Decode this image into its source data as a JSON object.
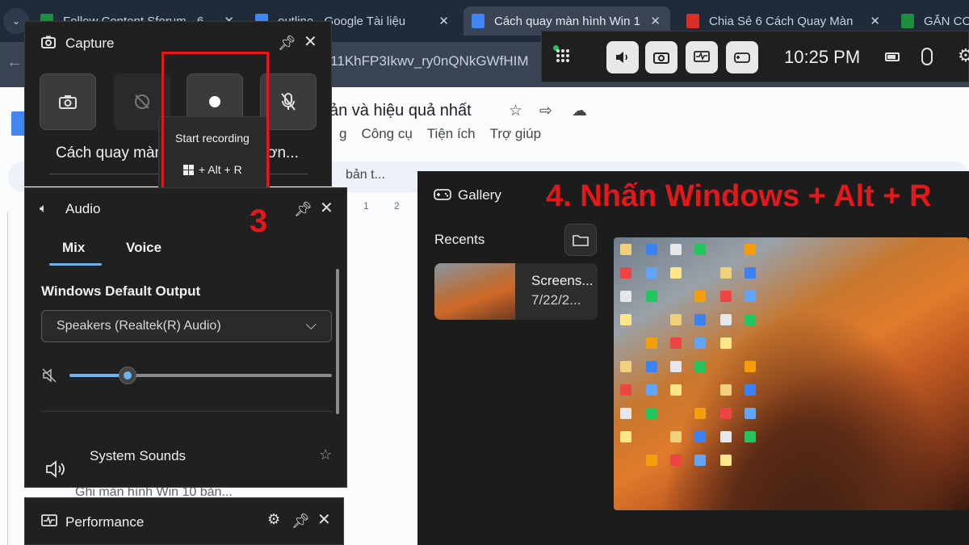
{
  "browser": {
    "tabs": [
      {
        "label": "Follow Content Sforum - 6",
        "favicon_color": "#1e8e3e"
      },
      {
        "label": "outline - Google Tài liệu",
        "favicon_color": "#4285f4"
      },
      {
        "label": "Cách quay màn hình Win 1",
        "favicon_color": "#4285f4"
      },
      {
        "label": "Chia Sẻ 6 Cách Quay Màn",
        "favicon_color": "#d93025"
      },
      {
        "label": "GẮN CO",
        "favicon_color": "#1e8e3e"
      }
    ],
    "url": "d/11KhFP3Ikwv_ry0nQNkGWfHIM"
  },
  "docs": {
    "title": "ản và hiệu quả nhất",
    "menu": [
      "g",
      "Công cụ",
      "Tiện ích",
      "Trợ giúp"
    ],
    "toolbar_text": "bản t...",
    "ruler_labels": [
      "1",
      "2"
    ],
    "outline_item": "Ghi màn hình Win 10 bản..."
  },
  "capture": {
    "title": "Capture",
    "label": "Cách quay màn ... ơn...",
    "label_left": "Cách quay màn",
    "label_right": "ơn...",
    "tooltip": {
      "title": "Start recording",
      "shortcut": "+ Alt + R"
    }
  },
  "annotations": {
    "step3": "3",
    "step4": "4. Nhấn Windows + Alt + R",
    "accent": "#e3181b"
  },
  "audio": {
    "title": "Audio",
    "tabs": [
      "Mix",
      "Voice"
    ],
    "section_label": "Windows Default Output",
    "output_device": "Speakers (Realtek(R) Audio)",
    "volume_fraction": 0.22,
    "system_sounds_label": "System Sounds"
  },
  "performance": {
    "title": "Performance"
  },
  "gallery": {
    "title": "Gallery",
    "recents_label": "Recents",
    "thumb_name": "Screens...",
    "thumb_date": "7/22/2..."
  },
  "gamebar": {
    "time": "10:25 PM"
  },
  "colors": {
    "accent_blue": "#6fb3ee",
    "panel_bg": "#202020"
  }
}
